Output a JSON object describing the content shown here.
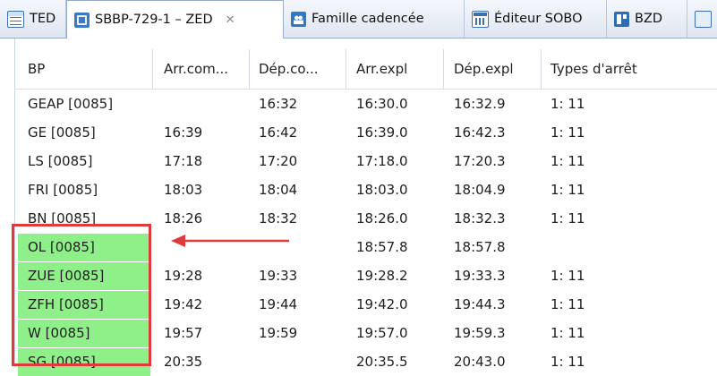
{
  "tabs": [
    {
      "label": "TED",
      "icon": "table-icon",
      "active": false
    },
    {
      "label": "SBBP-729-1 – ZED",
      "icon": "sbbp-icon",
      "active": true,
      "close": "✕"
    },
    {
      "label": "Famille cadencée",
      "icon": "famille-icon",
      "active": false
    },
    {
      "label": "Éditeur SOBO",
      "icon": "sobo-icon",
      "active": false
    },
    {
      "label": "BZD",
      "icon": "bzd-icon",
      "active": false
    },
    {
      "label": "",
      "icon": "more-icon",
      "active": false
    }
  ],
  "table": {
    "columns": [
      "BP",
      "Arr.com...",
      "Dép.co...",
      "Arr.expl",
      "Dép.expl",
      "Types d'arrêt"
    ],
    "rows": [
      {
        "bp": "GEAP [0085]",
        "arr_com": "",
        "dep_com": "16:32",
        "arr_expl": "16:30.0",
        "dep_expl": "16:32.9",
        "types": "1: 11",
        "highlight": false
      },
      {
        "bp": "GE [0085]",
        "arr_com": "16:39",
        "dep_com": "16:42",
        "arr_expl": "16:39.0",
        "dep_expl": "16:42.3",
        "types": "1: 11",
        "highlight": false
      },
      {
        "bp": "LS [0085]",
        "arr_com": "17:18",
        "dep_com": "17:20",
        "arr_expl": "17:18.0",
        "dep_expl": "17:20.3",
        "types": "1: 11",
        "highlight": false
      },
      {
        "bp": "FRI [0085]",
        "arr_com": "18:03",
        "dep_com": "18:04",
        "arr_expl": "18:03.0",
        "dep_expl": "18:04.9",
        "types": "1: 11",
        "highlight": false
      },
      {
        "bp": "BN [0085]",
        "arr_com": "18:26",
        "dep_com": "18:32",
        "arr_expl": "18:26.0",
        "dep_expl": "18:32.3",
        "types": "1: 11",
        "highlight": false
      },
      {
        "bp": "OL [0085]",
        "arr_com": "",
        "dep_com": "",
        "arr_expl": "18:57.8",
        "dep_expl": "18:57.8",
        "types": "",
        "highlight": true
      },
      {
        "bp": "ZUE [0085]",
        "arr_com": "19:28",
        "dep_com": "19:33",
        "arr_expl": "19:28.2",
        "dep_expl": "19:33.3",
        "types": "1: 11",
        "highlight": true
      },
      {
        "bp": "ZFH [0085]",
        "arr_com": "19:42",
        "dep_com": "19:44",
        "arr_expl": "19:42.0",
        "dep_expl": "19:44.3",
        "types": "1: 11",
        "highlight": true
      },
      {
        "bp": "W [0085]",
        "arr_com": "19:57",
        "dep_com": "19:59",
        "arr_expl": "19:57.0",
        "dep_expl": "19:59.3",
        "types": "1: 11",
        "highlight": true
      },
      {
        "bp": "SG [0085]",
        "arr_com": "20:35",
        "dep_com": "",
        "arr_expl": "20:35.5",
        "dep_expl": "20:43.0",
        "types": "1: 11",
        "highlight": true
      }
    ]
  },
  "colors": {
    "highlight": "#8ff089",
    "annotation": "#e03b3b"
  }
}
